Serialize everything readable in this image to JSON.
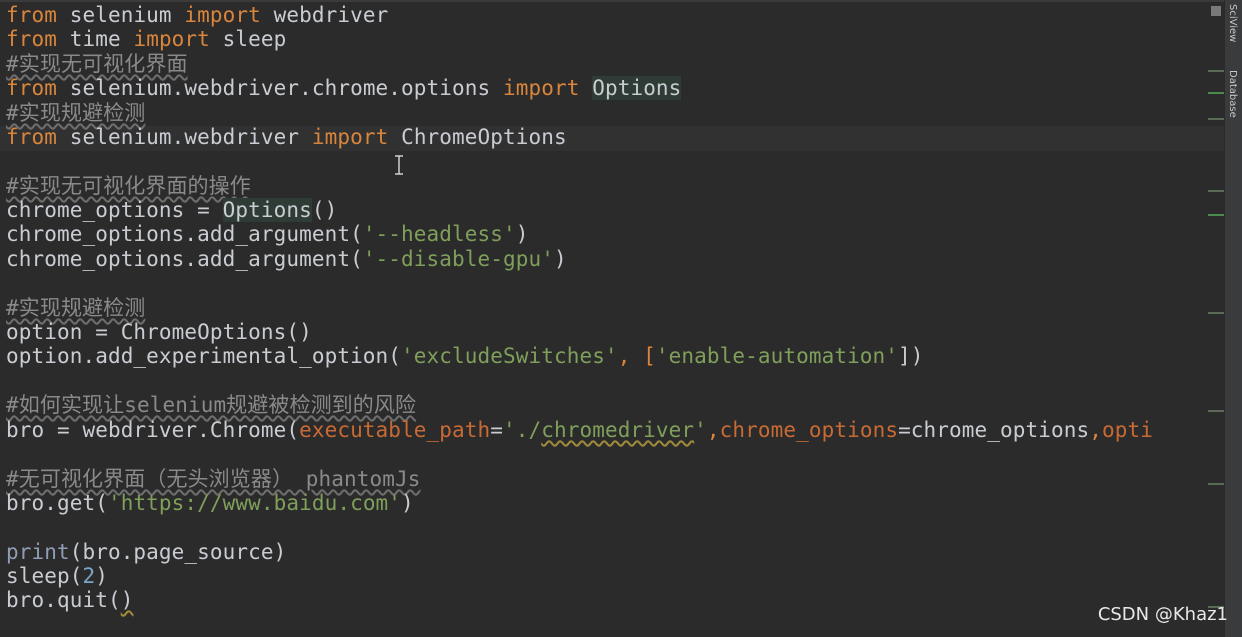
{
  "editor": {
    "lines": {
      "l1": {
        "a": "from",
        "b": " selenium ",
        "c": "import",
        "d": " webdriver"
      },
      "l2": {
        "a": "from",
        "b": " time ",
        "c": "import",
        "d": " sleep"
      },
      "l3": {
        "cmt": "#实现无可视化界面"
      },
      "l4": {
        "a": "from",
        "b": " selenium.webdriver.chrome.options ",
        "c": "import",
        "d": " ",
        "e": "Options"
      },
      "l5": {
        "cmt": "#实现规避检测"
      },
      "l6": {
        "a": "from",
        "b": " selenium.webdriver ",
        "c": "import",
        "d": " ChromeOptions"
      },
      "l8": {
        "cmt": "#实现无可视化界面的操作"
      },
      "l9": {
        "a": "chrome_options = ",
        "b": "Options",
        "c": "()"
      },
      "l10": {
        "a": "chrome_options.add_argument(",
        "b": "'--headless'",
        "c": ")"
      },
      "l11": {
        "a": "chrome_options.add_argument(",
        "b": "'--disable-gpu'",
        "c": ")"
      },
      "l13": {
        "cmt": "#实现规避检测"
      },
      "l14": {
        "a": "option = ChromeOptions()"
      },
      "l15": {
        "a": "option.add_experimental_option(",
        "b": "'excludeSwitches'",
        "c": ", [",
        "d": "'enable-automation'",
        "e": "])"
      },
      "l17": {
        "cmt": "#如何实现让selenium规避被检测到的风险"
      },
      "l18": {
        "a": "bro = webdriver.Chrome(",
        "b": "executable_path",
        "c": "=",
        "d": "'./",
        "e": "chromedriver",
        "f": "'",
        "g": ",",
        "h": "chrome_options",
        "i": "=chrome_options",
        "j": ",",
        "k": "opti"
      },
      "l20": {
        "cmt": "#无可视化界面（无头浏览器） phantomJs"
      },
      "l21": {
        "a": "bro.get(",
        "b": "'https://www.baidu.com'",
        "c": ")"
      },
      "l23": {
        "a": "print",
        "b": "(bro.page_source)"
      },
      "l24": {
        "a": "sleep(",
        "b": "2",
        "c": ")"
      },
      "l25": {
        "a": "bro.quit(",
        "b": ")"
      }
    }
  },
  "sidebar": {
    "tabs": [
      "SciView",
      "Database"
    ]
  },
  "watermark": "CSDN @Khaz1",
  "colors": {
    "background": "#2b2b2c",
    "keyword": "#d9853b",
    "string": "#7f9f5a",
    "comment": "#8a8a8a",
    "parameter": "#c86a33"
  }
}
